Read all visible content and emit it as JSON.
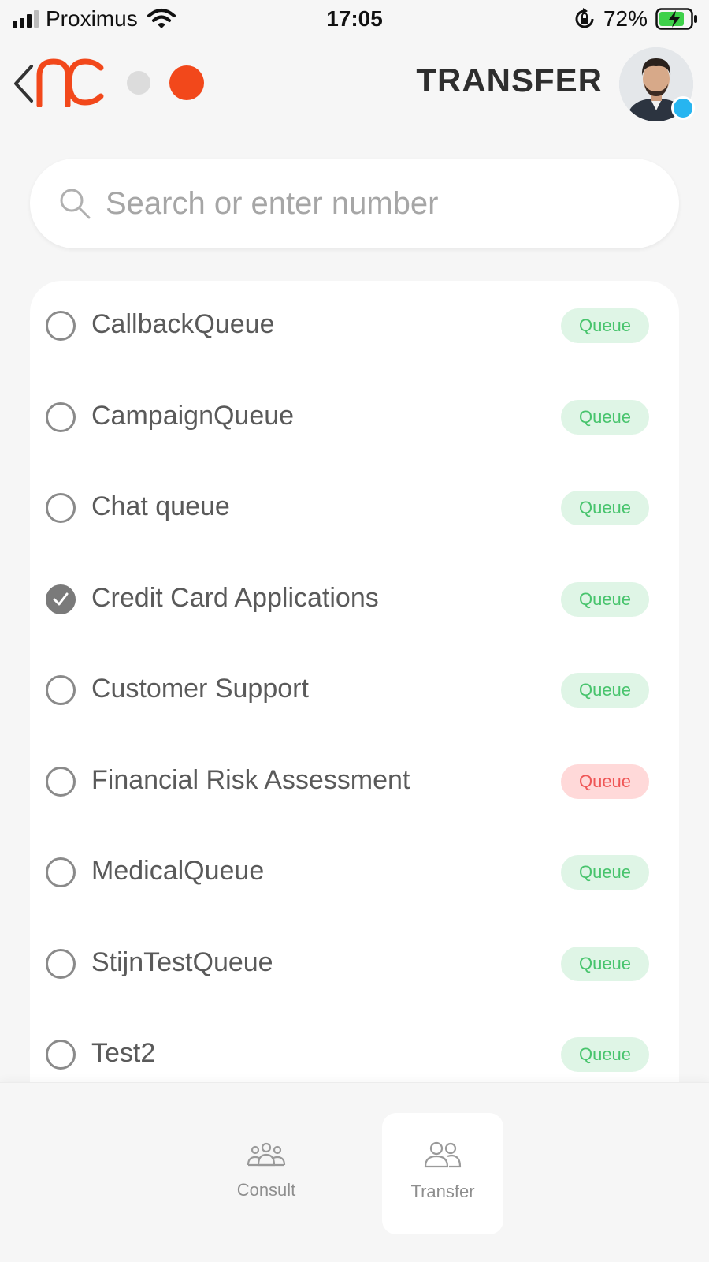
{
  "status_bar": {
    "carrier": "Proximus",
    "time": "17:05",
    "battery": "72%"
  },
  "header": {
    "title": "TRANSFER",
    "brand_color": "#f2481b",
    "presence_color": "#27b5f0"
  },
  "search": {
    "placeholder": "Search or enter number",
    "value": ""
  },
  "queues": [
    {
      "name": "CallbackQueue",
      "badge": "Queue",
      "badge_color": "green",
      "selected": false
    },
    {
      "name": "CampaignQueue",
      "badge": "Queue",
      "badge_color": "green",
      "selected": false
    },
    {
      "name": "Chat queue",
      "badge": "Queue",
      "badge_color": "green",
      "selected": false
    },
    {
      "name": "Credit Card Applications",
      "badge": "Queue",
      "badge_color": "green",
      "selected": true
    },
    {
      "name": "Customer Support",
      "badge": "Queue",
      "badge_color": "green",
      "selected": false
    },
    {
      "name": "Financial Risk Assessment",
      "badge": "Queue",
      "badge_color": "red",
      "selected": false
    },
    {
      "name": "MedicalQueue",
      "badge": "Queue",
      "badge_color": "green",
      "selected": false
    },
    {
      "name": "StijnTestQueue",
      "badge": "Queue",
      "badge_color": "green",
      "selected": false
    },
    {
      "name": "Test2",
      "badge": "Queue",
      "badge_color": "green",
      "selected": false
    }
  ],
  "bottom_nav": {
    "items": [
      {
        "label": "Consult",
        "icon": "group-icon",
        "active": false
      },
      {
        "label": "Transfer",
        "icon": "two-people-icon",
        "active": true
      }
    ]
  }
}
